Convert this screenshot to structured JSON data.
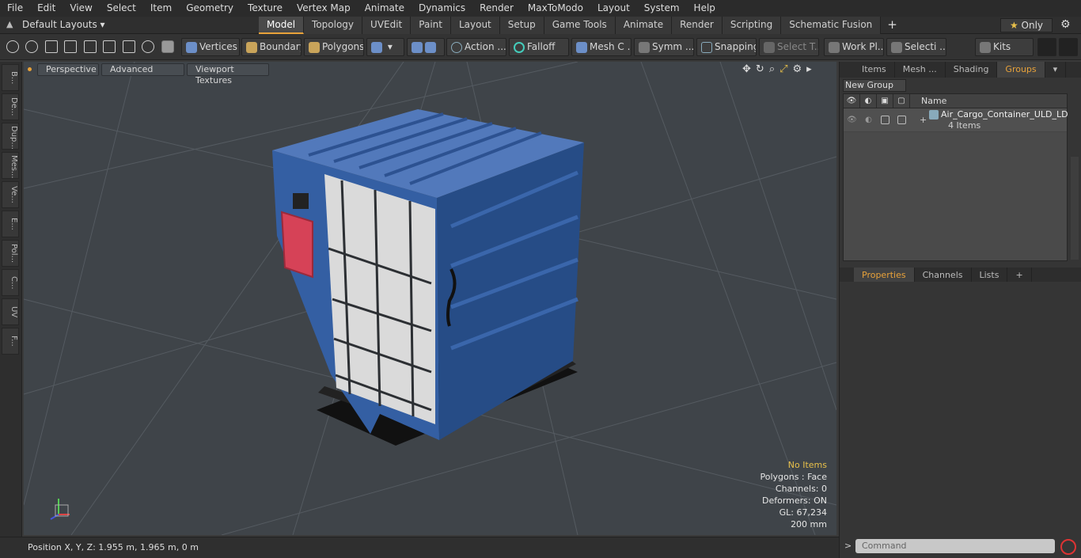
{
  "menu": [
    "File",
    "Edit",
    "View",
    "Select",
    "Item",
    "Geometry",
    "Texture",
    "Vertex Map",
    "Animate",
    "Dynamics",
    "Render",
    "MaxToModo",
    "Layout",
    "System",
    "Help"
  ],
  "layout_selector": "Default Layouts",
  "layout_tabs": [
    "Model",
    "Topology",
    "UVEdit",
    "Paint",
    "Layout",
    "Setup",
    "Game Tools",
    "Animate",
    "Render",
    "Scripting",
    "Schematic Fusion"
  ],
  "active_layout_tab": "Model",
  "only_label": "Only",
  "toolbar": {
    "vertices": "Vertices",
    "boundary": "Boundary",
    "polygons": "Polygons",
    "action": "Action ...",
    "falloff": "Falloff",
    "mesh": "Mesh C ...",
    "symmetry": "Symm ...",
    "snapping": "Snapping",
    "select_through": "Select T...",
    "work_plane": "Work Pl...",
    "selection": "Selecti ...",
    "kits": "Kits"
  },
  "left_tabs": [
    "B...",
    "De...",
    "Dup...",
    "Mes...",
    "Ve...",
    "E...",
    "Pol...",
    "C...",
    "UV",
    "F..."
  ],
  "viewport": {
    "view_mode": "Perspective",
    "shading": "Advanced",
    "textures": "Viewport Textures",
    "stats": {
      "selection": "No Items",
      "polygons": "Polygons : Face",
      "channels": "Channels: 0",
      "deformers": "Deformers: ON",
      "gl": "GL: 67,234",
      "scale": "200 mm"
    }
  },
  "status": {
    "position": "Position X, Y, Z:   1.955 m, 1.965 m, 0 m"
  },
  "right_panel": {
    "tabs": [
      "Items",
      "Mesh ...",
      "Shading",
      "Groups"
    ],
    "active_tab": "Groups",
    "new_group": "New Group",
    "table_header_name": "Name",
    "group_name": "Air_Cargo_Container_ULD_LD...",
    "group_count": "4 Items",
    "props_tabs": [
      "Properties",
      "Channels",
      "Lists"
    ],
    "active_props_tab": "Properties"
  },
  "command_placeholder": "Command",
  "colors": {
    "accent": "#e8a23a",
    "container_blue": "#2f5ea8",
    "net_panel": "#dcdcdc",
    "door_red": "#d64257"
  }
}
